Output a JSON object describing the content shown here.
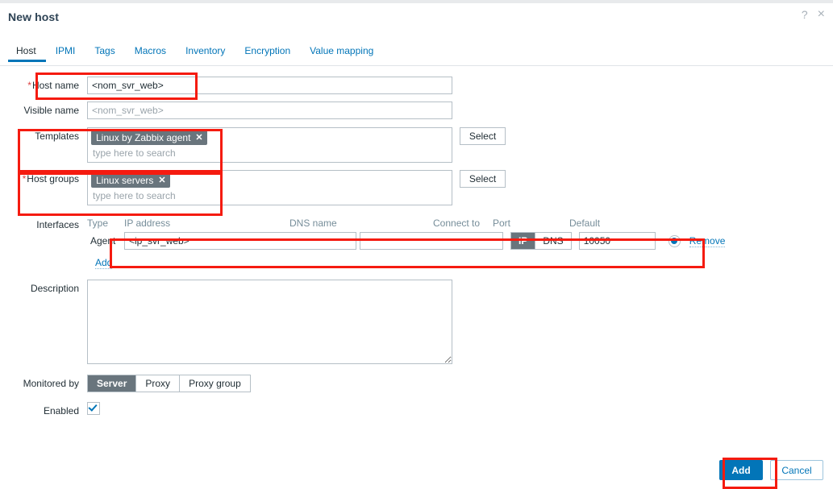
{
  "window": {
    "title": "New host",
    "help_icon": "?",
    "close_icon": "×"
  },
  "tabs": [
    {
      "label": "Host",
      "active": true
    },
    {
      "label": "IPMI",
      "active": false
    },
    {
      "label": "Tags",
      "active": false
    },
    {
      "label": "Macros",
      "active": false
    },
    {
      "label": "Inventory",
      "active": false
    },
    {
      "label": "Encryption",
      "active": false
    },
    {
      "label": "Value mapping",
      "active": false
    }
  ],
  "form": {
    "host_name": {
      "label": "Host name",
      "required_marker": "*",
      "value": "<nom_svr_web>"
    },
    "visible_name": {
      "label": "Visible name",
      "value": "",
      "placeholder": "<nom_svr_web>"
    },
    "templates": {
      "label": "Templates",
      "chips": [
        "Linux by Zabbix agent"
      ],
      "chip_remove_icon": "✕",
      "search_placeholder": "type here to search",
      "select_button": "Select"
    },
    "host_groups": {
      "label": "Host groups",
      "required_marker": "*",
      "chips": [
        "Linux servers"
      ],
      "chip_remove_icon": "✕",
      "search_placeholder": "type here to search",
      "select_button": "Select"
    },
    "interfaces": {
      "label": "Interfaces",
      "columns": {
        "type": "Type",
        "ip_address": "IP address",
        "dns_name": "DNS name",
        "connect_to": "Connect to",
        "port": "Port",
        "default": "Default"
      },
      "rows": [
        {
          "type": "Agent",
          "ip_address": "<ip_svr_web>",
          "dns_name": "",
          "connect_to_options": [
            "IP",
            "DNS"
          ],
          "connect_to_selected": "IP",
          "port": "10050",
          "is_default": true,
          "remove_label": "Remove"
        }
      ],
      "add_label": "Add"
    },
    "description": {
      "label": "Description",
      "value": ""
    },
    "monitored_by": {
      "label": "Monitored by",
      "options": [
        "Server",
        "Proxy",
        "Proxy group"
      ],
      "selected": "Server"
    },
    "enabled": {
      "label": "Enabled",
      "checked": true
    }
  },
  "footer": {
    "submit_label": "Add",
    "cancel_label": "Cancel"
  },
  "colors": {
    "accent_blue": "#0275b8",
    "chip_gray": "#69757d",
    "annotation_red": "#f51b10",
    "required_red": "#dd4444"
  }
}
